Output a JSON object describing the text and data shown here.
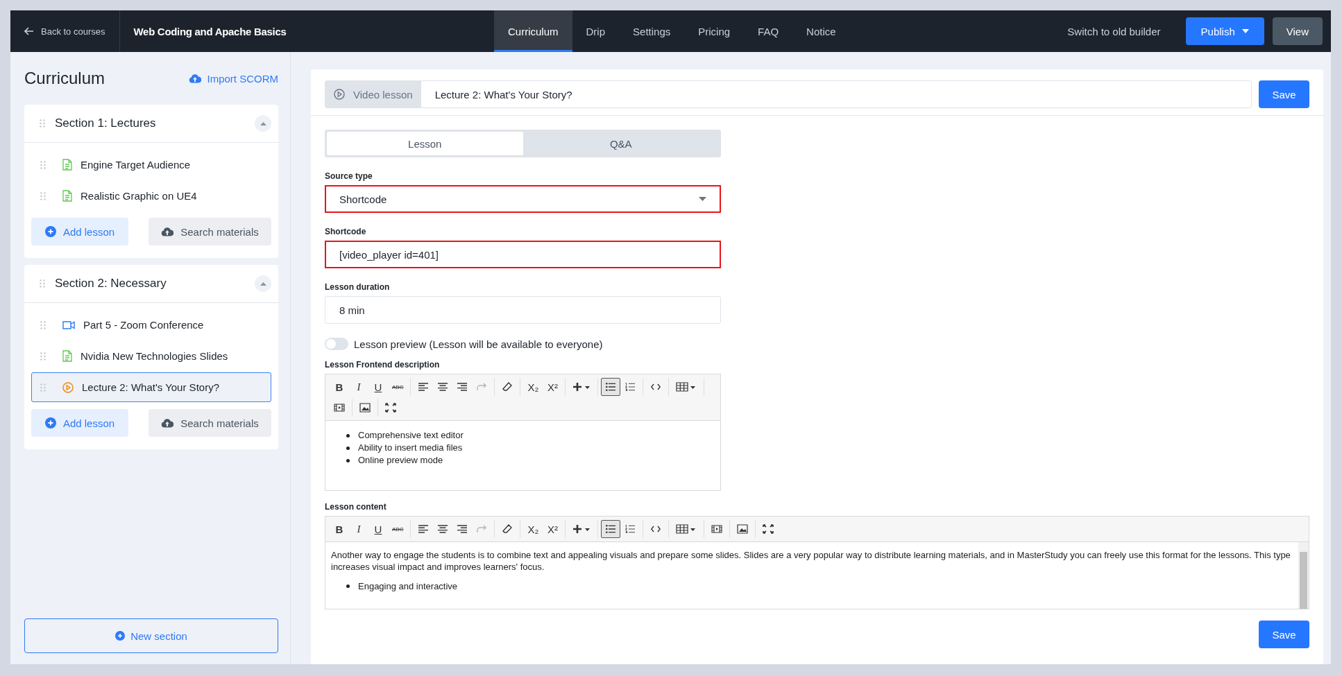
{
  "topbar": {
    "back_label": "Back to courses",
    "course_title": "Web Coding and Apache Basics",
    "tabs": [
      {
        "label": "Curriculum",
        "selected": true
      },
      {
        "label": "Drip",
        "selected": false
      },
      {
        "label": "Settings",
        "selected": false
      },
      {
        "label": "Pricing",
        "selected": false
      },
      {
        "label": "FAQ",
        "selected": false
      },
      {
        "label": "Notice",
        "selected": false
      }
    ],
    "switch_link": "Switch to old builder",
    "publish_button": "Publish",
    "view_button": "View"
  },
  "sidebar": {
    "title": "Curriculum",
    "import_link": "Import SCORM",
    "sections": [
      {
        "title": "Section 1: Lectures",
        "expanded": true,
        "lessons": [
          {
            "title": "Engine Target Audience",
            "kind": "text",
            "selected": false
          },
          {
            "title": "Realistic Graphic on UE4",
            "kind": "text",
            "selected": false
          }
        ],
        "add_button": "Add lesson",
        "search_button": "Search materials"
      },
      {
        "title": "Section 2: Necessary",
        "expanded": true,
        "lessons": [
          {
            "title": "Part 5 - Zoom Conference",
            "kind": "video",
            "selected": false
          },
          {
            "title": "Nvidia New Technologies Slides",
            "kind": "text",
            "selected": false
          },
          {
            "title": "Lecture 2: What's Your Story?",
            "kind": "play",
            "selected": true
          }
        ],
        "add_button": "Add lesson",
        "search_button": "Search materials"
      }
    ],
    "new_section_button": "New section"
  },
  "editor": {
    "lesson_type": "Video lesson",
    "lesson_title": "Lecture 2: What's Your Story?",
    "save_button": "Save",
    "tabs": [
      {
        "label": "Lesson",
        "selected": true
      },
      {
        "label": "Q&A",
        "selected": false
      }
    ],
    "source_type": {
      "label": "Source type",
      "value": "Shortcode",
      "highlighted": true
    },
    "shortcode": {
      "label": "Shortcode",
      "value": "[video_player id=401]",
      "highlighted": true
    },
    "duration": {
      "label": "Lesson duration",
      "value": "8 min",
      "highlighted": false
    },
    "preview_toggle": {
      "label": "Lesson preview (Lesson will be available to everyone)",
      "on": false
    },
    "description": {
      "label": "Lesson Frontend description",
      "toolbar": [
        [
          {
            "kind": "text",
            "label": "B",
            "active": false
          },
          {
            "kind": "text",
            "label": "I",
            "active": false
          },
          {
            "kind": "text",
            "label": "U",
            "active": false
          },
          {
            "kind": "text",
            "label": "ABC",
            "active": false
          }
        ],
        [
          {
            "kind": "align-left",
            "active": false
          },
          {
            "kind": "align-center",
            "active": false
          },
          {
            "kind": "align-right",
            "active": false
          },
          {
            "kind": "redo",
            "active": false
          }
        ],
        [
          {
            "kind": "eraser",
            "active": false
          }
        ],
        [
          {
            "kind": "text",
            "label": "X₂",
            "active": false
          },
          {
            "kind": "text",
            "label": "X²",
            "active": false
          }
        ],
        [
          {
            "kind": "plus",
            "active": false
          }
        ],
        [
          {
            "kind": "bullets",
            "active": true
          },
          {
            "kind": "numbers",
            "active": false
          }
        ],
        [
          {
            "kind": "code",
            "active": false
          }
        ],
        [
          {
            "kind": "table",
            "active": false
          }
        ],
        [
          {
            "kind": "media",
            "active": false
          }
        ],
        [
          {
            "kind": "image",
            "active": false
          }
        ],
        [
          {
            "kind": "fullscreen",
            "active": false
          }
        ]
      ],
      "bullets": [
        "Comprehensive text editor",
        "Ability to insert media files",
        "Online preview mode"
      ]
    },
    "content": {
      "label": "Lesson content",
      "toolbar": [
        [
          {
            "kind": "text",
            "label": "B",
            "active": false
          },
          {
            "kind": "text",
            "label": "I",
            "active": false
          },
          {
            "kind": "text",
            "label": "U",
            "active": false
          },
          {
            "kind": "text",
            "label": "ABC",
            "active": false
          }
        ],
        [
          {
            "kind": "align-left",
            "active": false
          },
          {
            "kind": "align-center",
            "active": false
          },
          {
            "kind": "align-right",
            "active": false
          },
          {
            "kind": "redo",
            "active": false
          }
        ],
        [
          {
            "kind": "eraser",
            "active": false
          }
        ],
        [
          {
            "kind": "text",
            "label": "X₂",
            "active": false
          },
          {
            "kind": "text",
            "label": "X²",
            "active": false
          }
        ],
        [
          {
            "kind": "plus",
            "active": false
          }
        ],
        [
          {
            "kind": "bullets",
            "active": true
          },
          {
            "kind": "numbers",
            "active": false
          }
        ],
        [
          {
            "kind": "code",
            "active": false
          }
        ],
        [
          {
            "kind": "table",
            "active": false
          }
        ],
        [
          {
            "kind": "media",
            "active": false
          }
        ],
        [
          {
            "kind": "image",
            "active": false
          }
        ],
        [
          {
            "kind": "fullscreen",
            "active": false
          }
        ]
      ],
      "paragraphs": [
        "Another way to engage the students is to combine text and appealing visuals and prepare some slides. Slides are a very popular way to distribute learning materials, and in MasterStudy you can freely use this format for the lessons. This type increases visual impact and improves learners' focus."
      ],
      "bullets": [
        "Engaging and interactive"
      ]
    },
    "bottom_save_button": "Save"
  }
}
